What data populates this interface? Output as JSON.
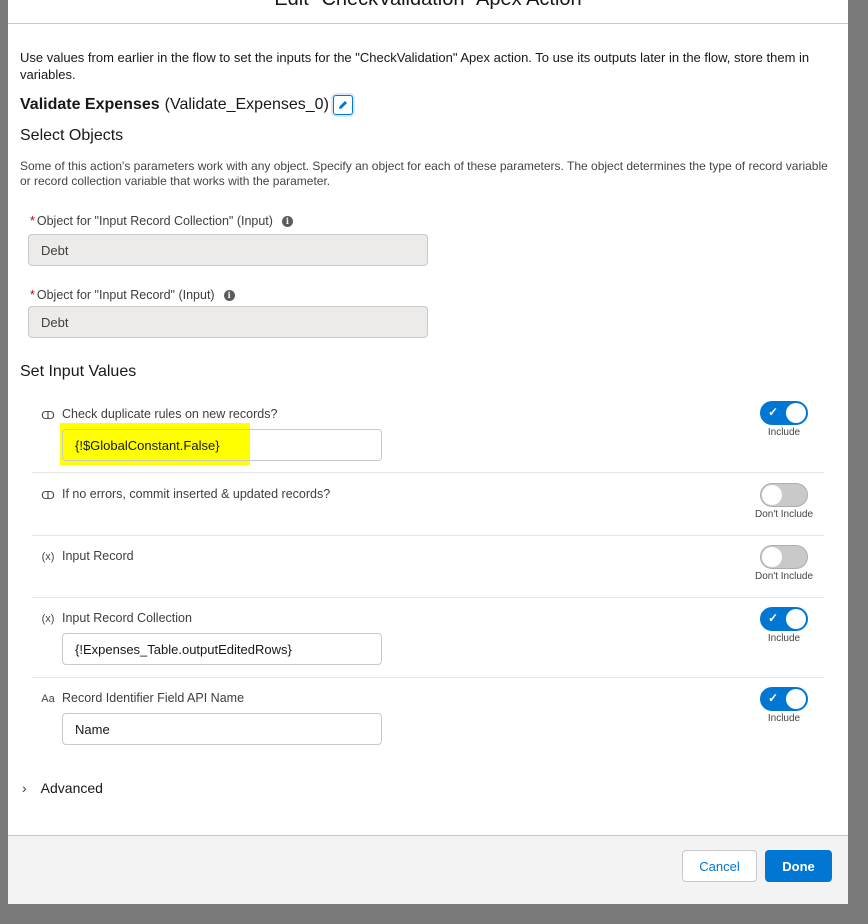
{
  "modal": {
    "title": "Edit \"CheckValidation\" Apex Action",
    "intro": "Use values from earlier in the flow to set the inputs for the \"CheckValidation\" Apex action. To use its outputs later in the flow, store them in variables.",
    "action_label": "Validate Expenses",
    "action_api_name": "(Validate_Expenses_0)"
  },
  "select_objects": {
    "title": "Select Objects",
    "description": "Some of this action's parameters work with any object. Specify an object for each of these parameters. The object determines the type of record variable or record collection variable that works with the parameter.",
    "fields": [
      {
        "required": "*",
        "label": "Object for \"Input Record Collection\" (Input)",
        "value": "Debt"
      },
      {
        "required": "*",
        "label": "Object for \"Input Record\" (Input)",
        "value": "Debt"
      }
    ]
  },
  "set_input_values": {
    "title": "Set Input Values",
    "rows": [
      {
        "icon": "boolean-icon",
        "icon_glyph": "ↀ",
        "label": "Check duplicate rules on new records?",
        "value": "{!$GlobalConstant.False}",
        "toggle_on": true,
        "toggle_text": "Include"
      },
      {
        "icon": "boolean-icon",
        "icon_glyph": "ↀ",
        "label": "If no errors, commit inserted & updated records?",
        "value": "",
        "toggle_on": false,
        "toggle_text": "Don't Include"
      },
      {
        "icon": "variable-icon",
        "icon_glyph": "(x)",
        "label": "Input Record",
        "value": "",
        "toggle_on": false,
        "toggle_text": "Don't Include"
      },
      {
        "icon": "variable-icon",
        "icon_glyph": "(x)",
        "label": "Input Record Collection",
        "value": "{!Expenses_Table.outputEditedRows}",
        "toggle_on": true,
        "toggle_text": "Include"
      },
      {
        "icon": "text-icon",
        "icon_glyph": "Aa",
        "label": "Record Identifier Field API Name",
        "value": "Name",
        "toggle_on": true,
        "toggle_text": "Include"
      }
    ]
  },
  "advanced_label": "Advanced",
  "footer": {
    "cancel_label": "Cancel",
    "done_label": "Done"
  },
  "colors": {
    "brand": "#0176d3",
    "highlight": "#ffff00",
    "backdrop": "#7a7a7a"
  }
}
